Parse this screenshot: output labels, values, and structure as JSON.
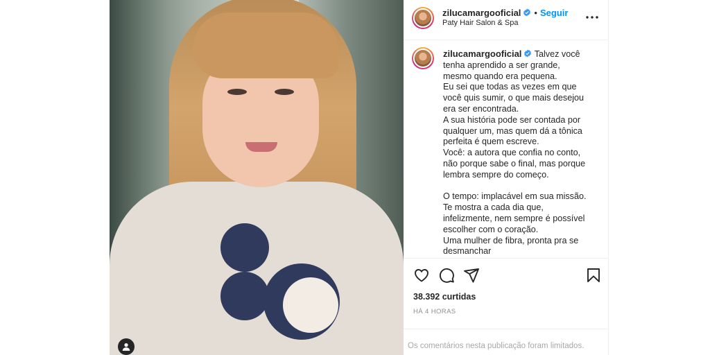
{
  "post": {
    "username": "zilucamargooficial",
    "follow_label": "Seguir",
    "separator": "•",
    "location": "Paty Hair Salon & Spa",
    "verified_color": "#3897f0",
    "accent_link_color": "#0095f6"
  },
  "caption": {
    "username": "zilucamargooficial",
    "first_line": "Talvez você",
    "lines": [
      "tenha aprendido a ser grande,",
      "mesmo quando era pequena.",
      "Eu sei que todas as vezes em que",
      "você quis sumir, o que mais desejou",
      "era ser encontrada.",
      "A sua história pode ser contada por",
      "qualquer um, mas quem dá a tônica",
      "perfeita é quem escreve.",
      "Você: a autora que confia no conto,",
      "não porque sabe o final, mas porque",
      "lembra sempre do começo.",
      "",
      "O tempo: implacável em sua missão.",
      "Te mostra a cada dia que,",
      "infelizmente, nem sempre é possível",
      "escolher com o coração.",
      "Uma mulher de fibra, pronta pra se",
      "desmanchar"
    ]
  },
  "actions": {
    "icons": [
      "heart-icon",
      "comment-icon",
      "share-icon",
      "bookmark-icon"
    ]
  },
  "stats": {
    "likes": "38.392 curtidas",
    "time_ago": "HÁ 4 HORAS"
  },
  "footer": {
    "comments_limited": "Os comentários nesta publicação foram limitados."
  }
}
